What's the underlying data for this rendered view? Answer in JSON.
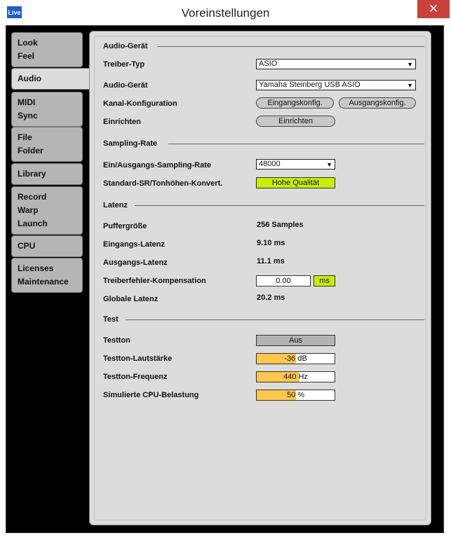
{
  "window": {
    "title": "Voreinstellungen",
    "app_icon": "Live",
    "close_glyph": "✕"
  },
  "sidebar": {
    "tabs": [
      {
        "lines": [
          "Look",
          "Feel"
        ]
      },
      {
        "lines": [
          "Audio"
        ]
      },
      {
        "lines": [
          "MIDI",
          "Sync"
        ]
      },
      {
        "lines": [
          "File",
          "Folder"
        ]
      },
      {
        "lines": [
          "Library"
        ]
      },
      {
        "lines": [
          "Record",
          "Warp",
          "Launch"
        ]
      },
      {
        "lines": [
          "CPU"
        ]
      },
      {
        "lines": [
          "Licenses",
          "Maintenance"
        ]
      }
    ],
    "active_index": 1
  },
  "audio_device": {
    "heading": "Audio-Gerät",
    "driver_label": "Treiber-Typ",
    "driver_value": "ASIO",
    "device_label": "Audio-Gerät",
    "device_value": "Yamaha Steinberg USB ASIO",
    "channel_label": "Kanal-Konfiguration",
    "input_config": "Eingangskonfig.",
    "output_config": "Ausgangskonfig.",
    "setup_label": "Einrichten",
    "setup_button": "Einrichten"
  },
  "sampling": {
    "heading": "Sampling-Rate",
    "rate_label": "Ein/Ausgangs-Sampling-Rate",
    "rate_value": "48000",
    "sr_label": "Standard-SR/Tonhöhen-Konvert.",
    "sr_value": "Hohe Qualität"
  },
  "latency": {
    "heading": "Latenz",
    "buffer_label": "Puffergröße",
    "buffer_value": "256 Samples",
    "in_label": "Eingangs-Latenz",
    "in_value": "9.10 ms",
    "out_label": "Ausgangs-Latenz",
    "out_value": "11.1 ms",
    "comp_label": "Treiberfehler-Kompensation",
    "comp_value": "0.00",
    "comp_unit": "ms",
    "global_label": "Globale Latenz",
    "global_value": "20.2 ms"
  },
  "test": {
    "heading": "Test",
    "tone_label": "Testton",
    "tone_value": "Aus",
    "volume_label": "Testton-Lautstärke",
    "volume_value": "-36 dB",
    "volume_fill": 0.5,
    "freq_label": "Testton-Frequenz",
    "freq_value": "440 Hz",
    "freq_fill": 0.54,
    "cpu_label": "Simulierte CPU-Belastung",
    "cpu_value": "50 %",
    "cpu_fill": 0.5
  },
  "colors": {
    "accent_fill": "#ffc84a",
    "active_green": "#c6f000",
    "close_red": "#c8423a"
  }
}
